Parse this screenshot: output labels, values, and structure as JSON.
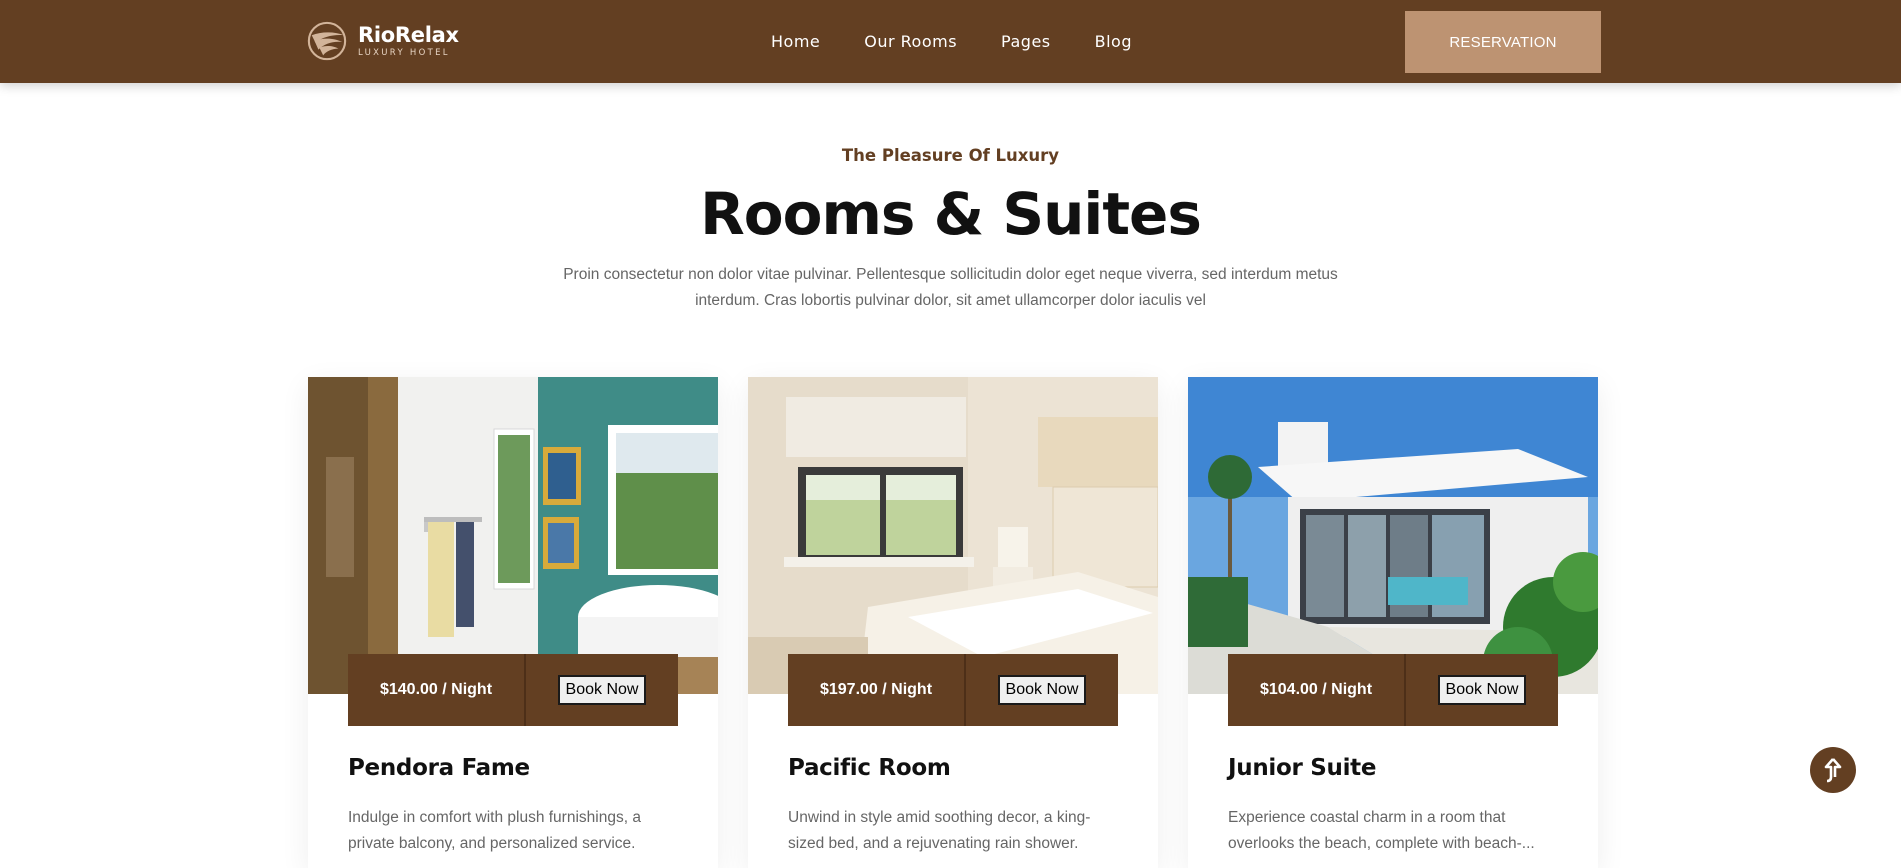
{
  "header": {
    "brand_name": "RioRelax",
    "brand_tagline": "LUXURY HOTEL",
    "logo_icon": "wing-logo-icon",
    "nav": [
      {
        "label": "Home"
      },
      {
        "label": "Our Rooms"
      },
      {
        "label": "Pages"
      },
      {
        "label": "Blog"
      }
    ],
    "reservation_label": "RESERVATION"
  },
  "section": {
    "kicker": "The Pleasure Of Luxury",
    "title": "Rooms & Suites",
    "intro": "Proin consectetur non dolor vitae pulvinar. Pellentesque sollicitudin dolor eget neque viverra, sed interdum metus interdum. Cras lobortis pulvinar dolor, sit amet ullamcorper dolor iaculis vel"
  },
  "rooms": [
    {
      "price": "$140.00 / Night",
      "book_label": "Book Now",
      "name": "Pendora Fame",
      "description": "Indulge in comfort with plush furnishings, a private balcony, and personalized service."
    },
    {
      "price": "$197.00 / Night",
      "book_label": "Book Now",
      "name": "Pacific Room",
      "description": "Unwind in style amid soothing decor, a king-sized bed, and a rejuvenating rain shower."
    },
    {
      "price": "$104.00 / Night",
      "book_label": "Book Now",
      "name": "Junior Suite",
      "description": "Experience coastal charm in a room that overlooks the beach, complete with beach-..."
    }
  ],
  "colors": {
    "brand_brown": "#633f22",
    "accent_tan": "#bd9372"
  },
  "scroll_top_icon": "arrow-up-icon"
}
